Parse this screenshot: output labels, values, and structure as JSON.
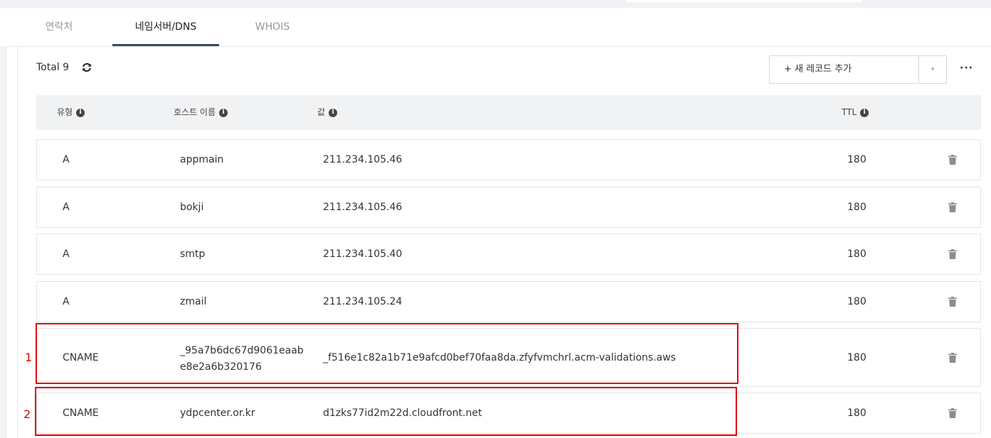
{
  "tabs": [
    {
      "label": "연락처",
      "active": false
    },
    {
      "label": "네임서버/DNS",
      "active": true
    },
    {
      "label": "WHOIS",
      "active": false
    }
  ],
  "toolbar": {
    "total_label": "Total 9",
    "add_record_label": "+ 새 레코드 추가",
    "dropdown_icon": "▾",
    "more_icon": "···"
  },
  "table": {
    "headers": {
      "type": "유형",
      "host": "호스트 이름",
      "value": "값",
      "ttl": "TTL"
    },
    "rows": [
      {
        "type": "A",
        "host": "appmain",
        "value": "211.234.105.46",
        "ttl": "180"
      },
      {
        "type": "A",
        "host": "bokji",
        "value": "211.234.105.46",
        "ttl": "180"
      },
      {
        "type": "A",
        "host": "smtp",
        "value": "211.234.105.40",
        "ttl": "180"
      },
      {
        "type": "A",
        "host": "zmail",
        "value": "211.234.105.24",
        "ttl": "180"
      },
      {
        "type": "CNAME",
        "host_line1": "_95a7b6dc67d9061eaab",
        "host_line2": "e8e2a6b320176",
        "value": "_f516e1c82a1b71e9afcd0bef70faa8da.zfyfvmchrl.acm-validations.aws",
        "ttl": "180"
      },
      {
        "type": "CNAME",
        "host": "ydpcenter.or.kr",
        "value": "d1zks77id2m22d.cloudfront.net",
        "ttl": "180"
      }
    ]
  },
  "annotations": {
    "marker1": "1",
    "marker2": "2",
    "color": "#e00000"
  },
  "colors": {
    "active_tab_underline": "#3d4a5c",
    "header_bg": "#f1f2f4"
  }
}
